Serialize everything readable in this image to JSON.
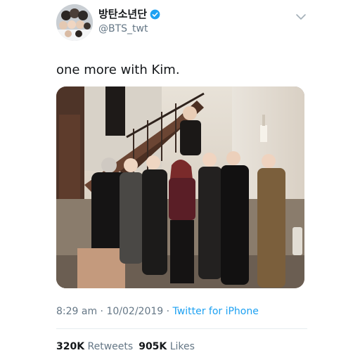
{
  "tweet": {
    "display_name": "방탄소년단",
    "handle": "@BTS_twt",
    "text": "one more with Kim.",
    "time": "8:29 am",
    "separator": " · ",
    "date": "10/02/2019",
    "source": "Twitter for iPhone",
    "retweets_count": "320K",
    "retweets_label": "Retweets",
    "likes_count": "905K",
    "likes_label": "Likes"
  },
  "icons": {
    "verified": "verified-badge-icon",
    "menu": "chevron-down-icon"
  },
  "colors": {
    "accent": "#1da1f2",
    "text_primary": "#14171a",
    "text_secondary": "#657786",
    "divider": "#e6ecf0"
  }
}
